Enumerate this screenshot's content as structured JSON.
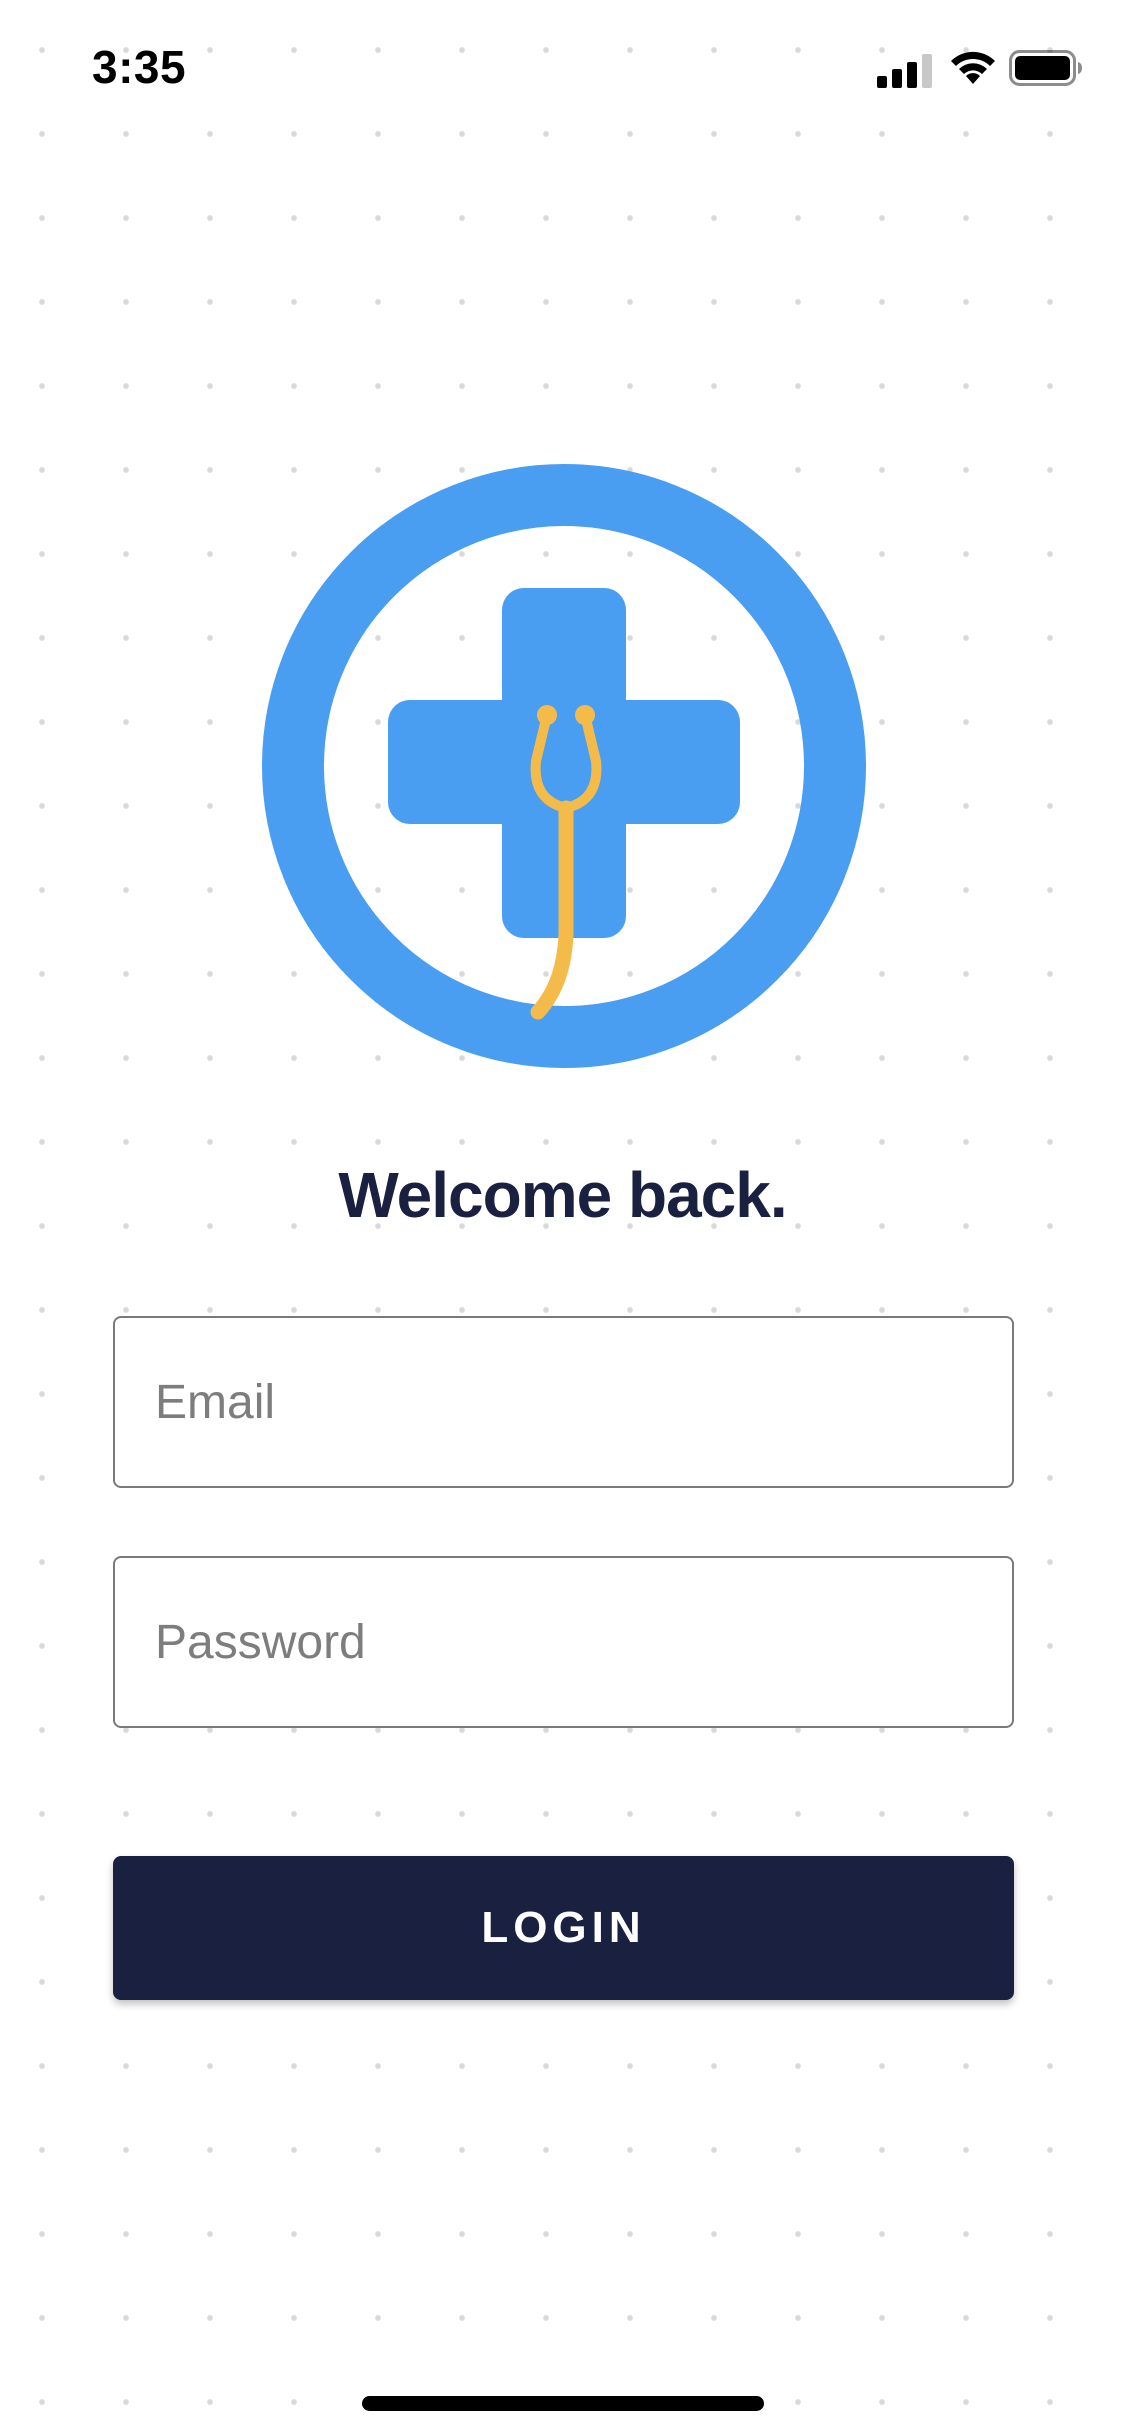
{
  "status_bar": {
    "time": "3:35",
    "icons": [
      "cellular-signal-icon",
      "wifi-icon",
      "battery-icon"
    ]
  },
  "logo": {
    "icon": "medical-cross-stethoscope-logo",
    "colors": {
      "ring": "#4a9ef2",
      "cross": "#4a9ef2",
      "stethoscope": "#f5bb4a"
    }
  },
  "login": {
    "heading": "Welcome back.",
    "email_placeholder": "Email",
    "email_value": "",
    "password_placeholder": "Password",
    "password_value": "",
    "button_label": "LOGIN"
  },
  "colors": {
    "primary_dark": "#1a2140",
    "field_border": "#7a7a7a",
    "placeholder": "#7d7d7d",
    "background": "#ffffff",
    "dot_pattern": "#d9d9d9"
  }
}
